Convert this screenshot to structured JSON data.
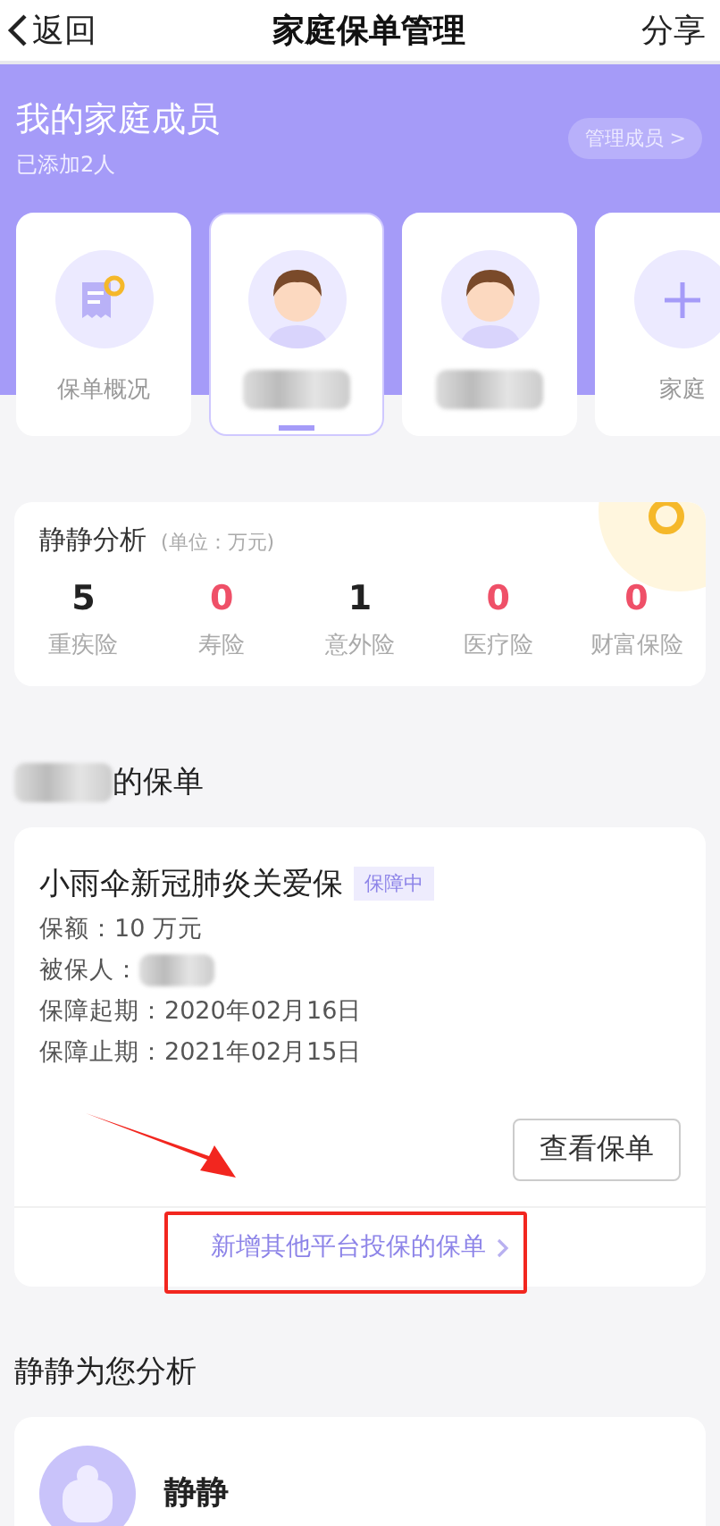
{
  "nav": {
    "back": "返回",
    "title": "家庭保单管理",
    "share": "分享"
  },
  "family": {
    "title": "我的家庭成员",
    "subtitle": "已添加2人",
    "manage_button": "管理成员 >",
    "members": [
      {
        "kind": "overview",
        "label": "保单概况",
        "selected": false
      },
      {
        "kind": "person",
        "selected": true
      },
      {
        "kind": "person",
        "selected": false
      },
      {
        "kind": "add",
        "label": "家庭",
        "selected": false
      }
    ]
  },
  "analysis": {
    "title": "静静分析",
    "unit": "(单位：万元)",
    "stats": [
      {
        "value": "5",
        "label": "重疾险",
        "alert": false
      },
      {
        "value": "0",
        "label": "寿险",
        "alert": true
      },
      {
        "value": "1",
        "label": "意外险",
        "alert": false
      },
      {
        "value": "0",
        "label": "医疗险",
        "alert": true
      },
      {
        "value": "0",
        "label": "财富保险",
        "alert": true
      }
    ]
  },
  "policies": {
    "title_suffix": "的保单",
    "items": [
      {
        "name": "小雨伞新冠肺炎关爱保",
        "status": "保障中",
        "fields": [
          {
            "label": "保额：",
            "value": "10 万元",
            "redacted": false
          },
          {
            "label": "被保人：",
            "redacted": true
          },
          {
            "label": "保障起期：",
            "value": "2020年02月16日",
            "redacted": false
          },
          {
            "label": "保障止期：",
            "value": "2021年02月15日",
            "redacted": false
          }
        ],
        "view_button": "查看保单"
      }
    ],
    "add_link": "新增其他平台投保的保单"
  },
  "advice": {
    "title": "静静为您分析",
    "name": "静静"
  }
}
